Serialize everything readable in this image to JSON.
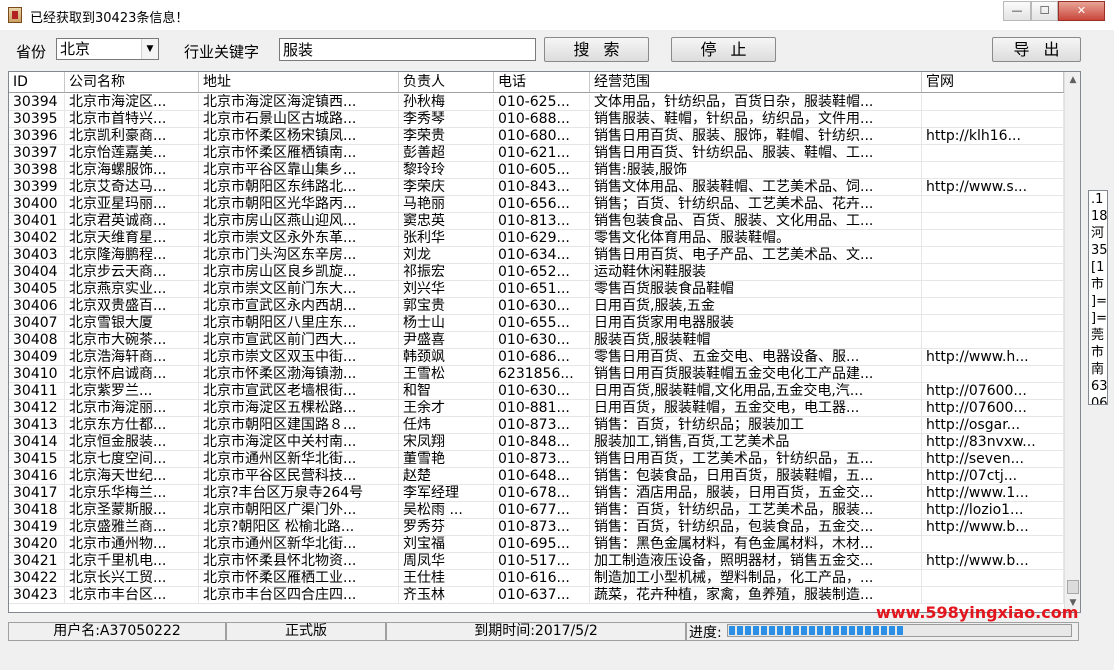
{
  "window": {
    "title": "已经获取到30423条信息！",
    "min": "—",
    "max": "☐",
    "close": "✕"
  },
  "search": {
    "province_label": "省份",
    "province_value": "北京",
    "keyword_label": "行业关键字",
    "keyword_value": "服装",
    "search_button": "搜索",
    "stop_button": "停止",
    "export_button": "导出"
  },
  "table": {
    "columns": [
      "ID",
      "公司名称",
      "地址",
      "负责人",
      "电话",
      "经营范围",
      "官网"
    ],
    "rows": [
      [
        "30394",
        "北京市海淀区...",
        "北京市海淀区海淀镇西...",
        "孙秋梅",
        "010-625...",
        "文体用品，针纺织品，百货日杂，服装鞋帽...",
        ""
      ],
      [
        "30395",
        "北京市首特兴...",
        "北京市石景山区古城路...",
        "李秀琴",
        "010-688...",
        "销售服装、鞋帽，针织品，纺织品，文件用...",
        ""
      ],
      [
        "30396",
        "北京凯利豪商...",
        "北京市怀柔区杨宋镇凤...",
        "李荣贵",
        "010-680...",
        "销售日用百货、服装、服饰，鞋帽、针纺织...",
        "http://klh16..."
      ],
      [
        "30397",
        "北京怡莲嘉美...",
        "北京市怀柔区雁栖镇南...",
        "彭善超",
        "010-621...",
        "销售日用百货、针纺织品、服装、鞋帽、工...",
        ""
      ],
      [
        "30398",
        "北京海螺服饰...",
        "北京市平谷区靠山集乡...",
        "黎玲玲",
        "010-605...",
        "销售:服装,服饰",
        ""
      ],
      [
        "30399",
        "北京艾奇达马...",
        "北京市朝阳区东纬路北...",
        "李荣庆",
        "010-843...",
        "销售文体用品、服装鞋帽、工艺美术品、饲...",
        "http://www.s..."
      ],
      [
        "30400",
        "北京亚星玛丽...",
        "北京市朝阳区光华路丙...",
        "马艳丽",
        "010-656...",
        "销售；百货、针纺织品、工艺美术品、花卉...",
        ""
      ],
      [
        "30401",
        "北京君英诚商...",
        "北京市房山区燕山迎风...",
        "窦忠英",
        "010-813...",
        "销售包装食品、百货、服装、文化用品、工...",
        ""
      ],
      [
        "30402",
        "北京天维育星...",
        "北京市崇文区永外东革...",
        "张利华",
        "010-629...",
        "零售文化体育用品、服装鞋帽。",
        ""
      ],
      [
        "30403",
        "北京隆海鹏程...",
        "北京市门头沟区东辛房...",
        "刘龙",
        "010-634...",
        "销售日用百货、电子产品、工艺美术品、文...",
        ""
      ],
      [
        "30404",
        "北京步云天商...",
        "北京市房山区良乡凯旋...",
        "祁振宏",
        "010-652...",
        "运动鞋休闲鞋服装",
        ""
      ],
      [
        "30405",
        "北京燕京实业...",
        "北京市崇文区前门东大...",
        "刘兴华",
        "010-651...",
        "零售百货服装食品鞋帽",
        ""
      ],
      [
        "30406",
        "北京双贵盛百...",
        "北京市宣武区永内西胡...",
        "郭宝贵",
        "010-630...",
        "日用百货,服装,五金",
        ""
      ],
      [
        "30407",
        "北京雪银大厦",
        "北京市朝阳区八里庄东...",
        "杨士山",
        "010-655...",
        "日用百货家用电器服装",
        ""
      ],
      [
        "30408",
        "北京市大碗茶...",
        "北京市宣武区前门西大...",
        "尹盛喜",
        "010-630...",
        "服装百货,服装鞋帽",
        ""
      ],
      [
        "30409",
        "北京浩海轩商...",
        "北京市崇文区双玉中街...",
        "韩颈飒",
        "010-686...",
        "零售日用百货、五金交电、电器设备、服...",
        "http://www.h..."
      ],
      [
        "30410",
        "北京怀启诚商...",
        "北京市怀柔区渤海镇渤...",
        "王雪松",
        "6231856...",
        "销售日用百货服装鞋帽五金交电化工产品建...",
        ""
      ],
      [
        "30411",
        "北京紫罗兰...",
        "北京市宣武区老墙根街...",
        "和智",
        "010-630...",
        "日用百货,服装鞋帽,文化用品,五金交电,汽...",
        "http://07600..."
      ],
      [
        "30412",
        "北京市海淀丽...",
        "北京市海淀区五棵松路...",
        "王余才",
        "010-881...",
        "日用百货，服装鞋帽，五金交电，电工器...",
        "http://07600..."
      ],
      [
        "30413",
        "北京东方仕都...",
        "北京市朝阳区建国路８...",
        "任炜",
        "010-873...",
        "销售：百货，针纺织品；服装加工",
        "http://osgar..."
      ],
      [
        "30414",
        "北京恒金服装...",
        "北京市海淀区中关村南...",
        "宋凤翔",
        "010-848...",
        "服装加工,销售,百货,工艺美术品",
        "http://83nvxw..."
      ],
      [
        "30415",
        "北京七度空间...",
        "北京市通州区新华北街...",
        "董雪艳",
        "010-873...",
        "销售日用百货，工艺美术品，针纺织品，五...",
        "http://seven..."
      ],
      [
        "30416",
        "北京海天世纪...",
        "北京市平谷区民营科技...",
        "赵楚",
        "010-648...",
        "销售：包装食品，日用百货，服装鞋帽，五...",
        "http://07ctj..."
      ],
      [
        "30417",
        "北京乐华梅兰...",
        "北京?丰台区万泉寺264号",
        "李军经理",
        "010-678...",
        "销售：酒店用品，服装，日用百货，五金交...",
        "http://www.1..."
      ],
      [
        "30418",
        "北京圣蒙斯服...",
        "北京市朝阳区广渠门外...",
        "吴松雨 ...",
        "010-677...",
        "销售：百货，针纺织品，工艺美术品，服装...",
        "http://lozio1..."
      ],
      [
        "30419",
        "北京盛雅兰商...",
        "北京?朝阳区 松榆北路...",
        "罗秀芬",
        "010-873...",
        "销售：百货，针纺织品，包装食品，五金交...",
        "http://www.b..."
      ],
      [
        "30420",
        "北京市通州物...",
        "北京市通州区新华北街...",
        "刘宝福",
        "010-695...",
        "销售：黑色金属材料，有色金属材料，木材...",
        ""
      ],
      [
        "30421",
        "北京千里机电...",
        "北京市怀柔县怀北物资...",
        "周凤华",
        "010-517...",
        "加工制造液压设备，照明器材，销售五金交...",
        "http://www.b..."
      ],
      [
        "30422",
        "北京长兴工贸...",
        "北京市怀柔区雁栖工业...",
        "王仕桂",
        "010-616...",
        "制造加工小型机械，塑料制品，化工产品，...",
        ""
      ],
      [
        "30423",
        "北京市丰台区...",
        "北京市丰台区四合庄四...",
        "齐玉林",
        "010-637...",
        "蔬菜，花卉种植，家禽，鱼养殖，服装制造...",
        ""
      ]
    ]
  },
  "side_peek": [
    ".1",
    "18",
    "河",
    "35",
    "[1",
    "市",
    "]=",
    "]=",
    "莞",
    "市",
    "南",
    "63",
    "06"
  ],
  "watermark": "www.598yingxiao.com",
  "status": {
    "user": "用户名:A37050222",
    "edition": "正式版",
    "expiry": "到期时间:2017/5/2",
    "progress_label": "进度:",
    "progress_value": 0.51
  },
  "colors": {
    "watermark": "#e2151d",
    "progress": "#2c8fe6"
  }
}
